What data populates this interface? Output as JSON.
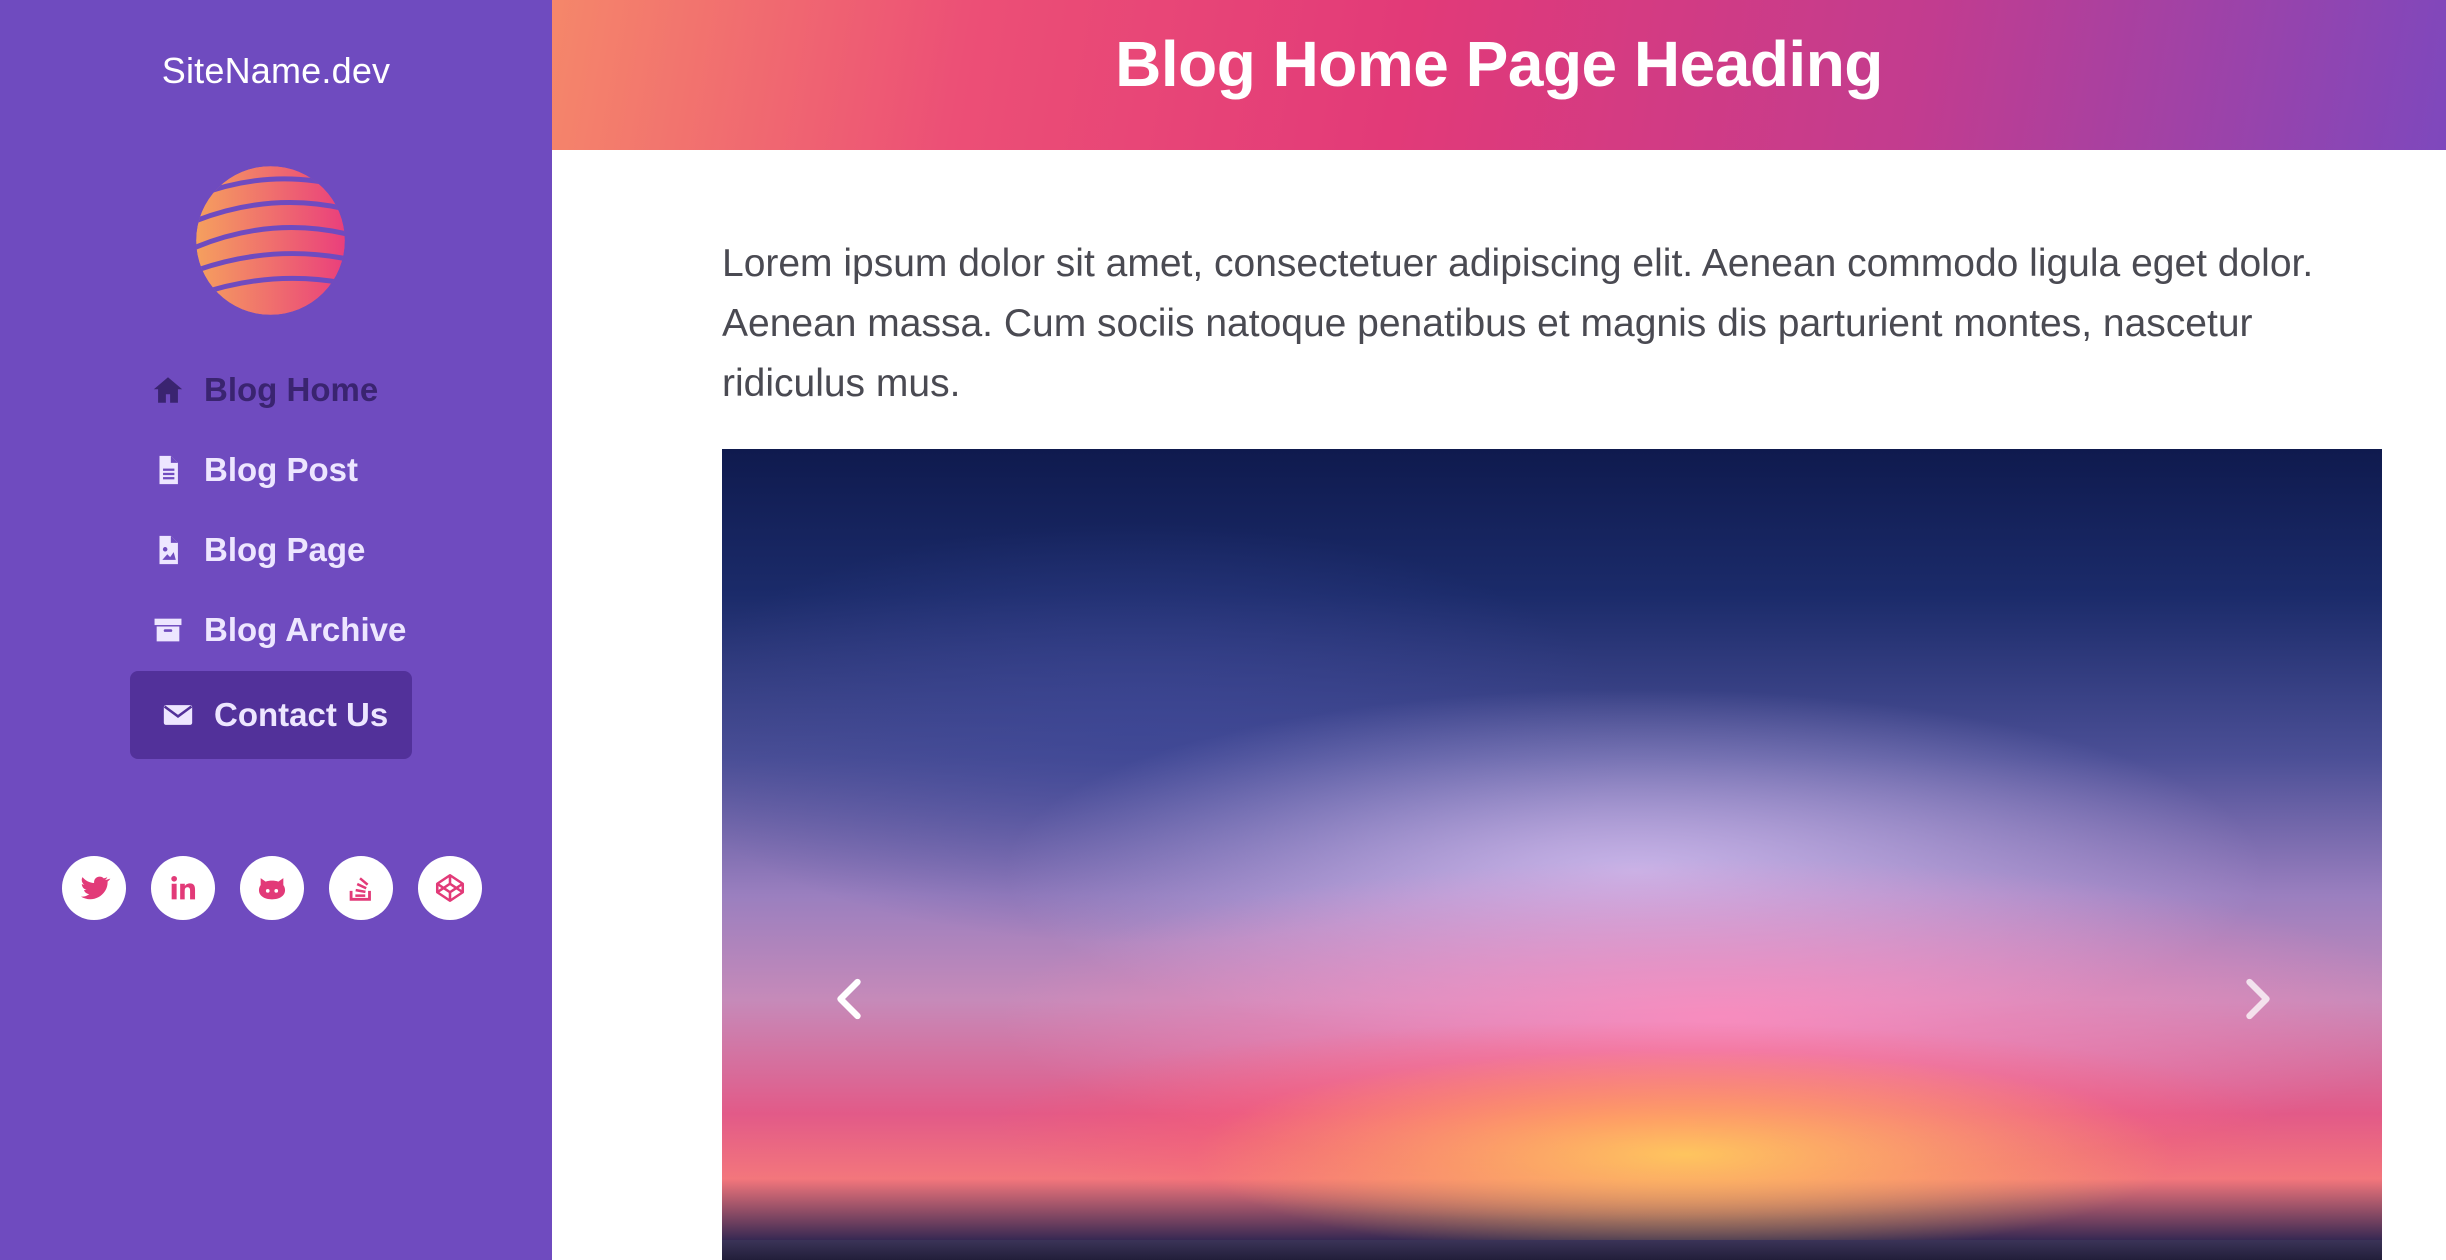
{
  "sidebar": {
    "site_name": "SiteName.dev",
    "logo_icon": "globe-logo",
    "nav": [
      {
        "label": "Blog Home",
        "icon": "home-icon",
        "active": true
      },
      {
        "label": "Blog Post",
        "icon": "file-text-icon"
      },
      {
        "label": "Blog Page",
        "icon": "file-image-icon"
      },
      {
        "label": "Blog Archive",
        "icon": "archive-icon"
      },
      {
        "label": "Contact Us",
        "icon": "envelope-icon"
      }
    ],
    "socials": [
      "twitter-icon",
      "linkedin-icon",
      "github-icon",
      "stack-overflow-icon",
      "codepen-icon"
    ]
  },
  "header": {
    "title": "Blog Home Page Heading"
  },
  "main": {
    "intro": "Lorem ipsum dolor sit amet, consectetuer adipiscing elit. Aenean commodo ligula eget dolor. Aenean massa. Cum sociis natoque penatibus et magnis dis parturient montes, nascetur ridiculus mus.",
    "carousel": {
      "image": "sunset-sky-photo",
      "prev_icon": "chevron-left-icon",
      "next_icon": "chevron-right-icon"
    }
  },
  "colors": {
    "sidebar_bg": "#6f4bbf",
    "accent_pink": "#e23a78",
    "active_nav": "#3a2470",
    "contact_bg": "#52319a"
  }
}
